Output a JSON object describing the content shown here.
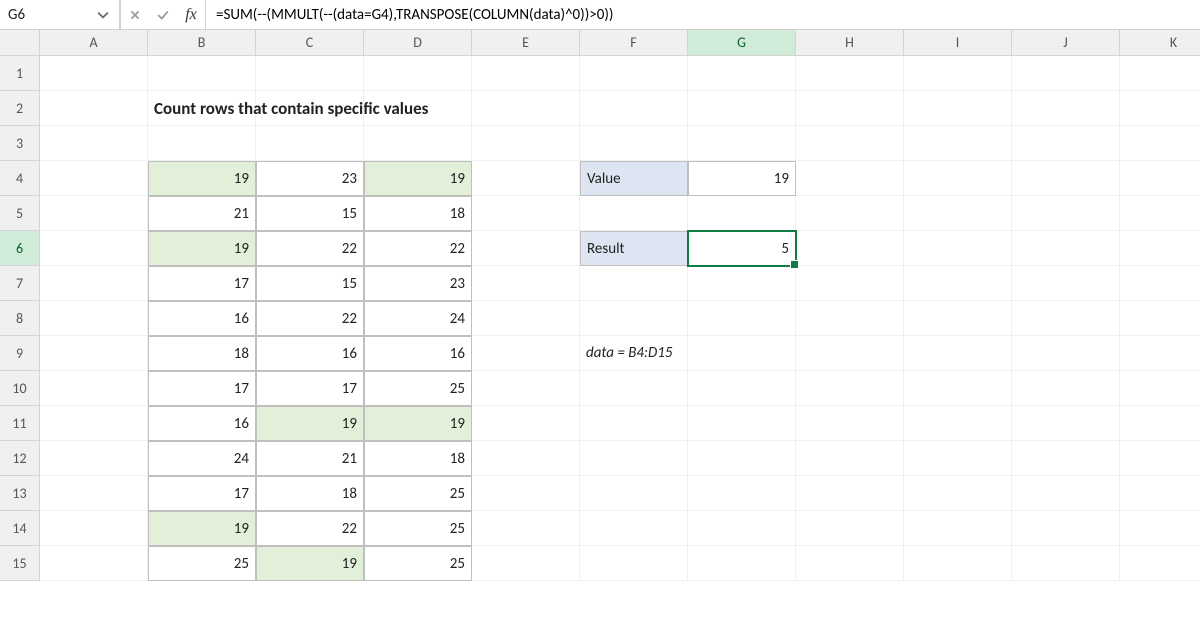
{
  "formula_bar": {
    "name_box": "G6",
    "fx_label": "fx",
    "formula": "=SUM(--(MMULT(--(data=G4),TRANSPOSE(COLUMN(data)^0))>0))"
  },
  "columns": [
    "A",
    "B",
    "C",
    "D",
    "E",
    "F",
    "G",
    "H",
    "I",
    "J",
    "K"
  ],
  "rows": [
    "1",
    "2",
    "3",
    "4",
    "5",
    "6",
    "7",
    "8",
    "9",
    "10",
    "11",
    "12",
    "13",
    "14",
    "15"
  ],
  "title": "Count rows that contain specific values",
  "data_table": [
    {
      "r": 4,
      "vals": [
        19,
        23,
        19
      ],
      "hl": [
        true,
        false,
        true
      ]
    },
    {
      "r": 5,
      "vals": [
        21,
        15,
        18
      ],
      "hl": [
        false,
        false,
        false
      ]
    },
    {
      "r": 6,
      "vals": [
        19,
        22,
        22
      ],
      "hl": [
        true,
        false,
        false
      ]
    },
    {
      "r": 7,
      "vals": [
        17,
        15,
        23
      ],
      "hl": [
        false,
        false,
        false
      ]
    },
    {
      "r": 8,
      "vals": [
        16,
        22,
        24
      ],
      "hl": [
        false,
        false,
        false
      ]
    },
    {
      "r": 9,
      "vals": [
        18,
        16,
        16
      ],
      "hl": [
        false,
        false,
        false
      ]
    },
    {
      "r": 10,
      "vals": [
        17,
        17,
        25
      ],
      "hl": [
        false,
        false,
        false
      ]
    },
    {
      "r": 11,
      "vals": [
        16,
        19,
        19
      ],
      "hl": [
        false,
        true,
        true
      ]
    },
    {
      "r": 12,
      "vals": [
        24,
        21,
        18
      ],
      "hl": [
        false,
        false,
        false
      ]
    },
    {
      "r": 13,
      "vals": [
        17,
        18,
        25
      ],
      "hl": [
        false,
        false,
        false
      ]
    },
    {
      "r": 14,
      "vals": [
        19,
        22,
        25
      ],
      "hl": [
        true,
        false,
        false
      ]
    },
    {
      "r": 15,
      "vals": [
        25,
        19,
        25
      ],
      "hl": [
        false,
        true,
        false
      ]
    }
  ],
  "side": {
    "value_label": "Value",
    "value": "19",
    "result_label": "Result",
    "result": "5",
    "range_note": "data = B4:D15"
  },
  "active_col": "G",
  "active_row": "6"
}
